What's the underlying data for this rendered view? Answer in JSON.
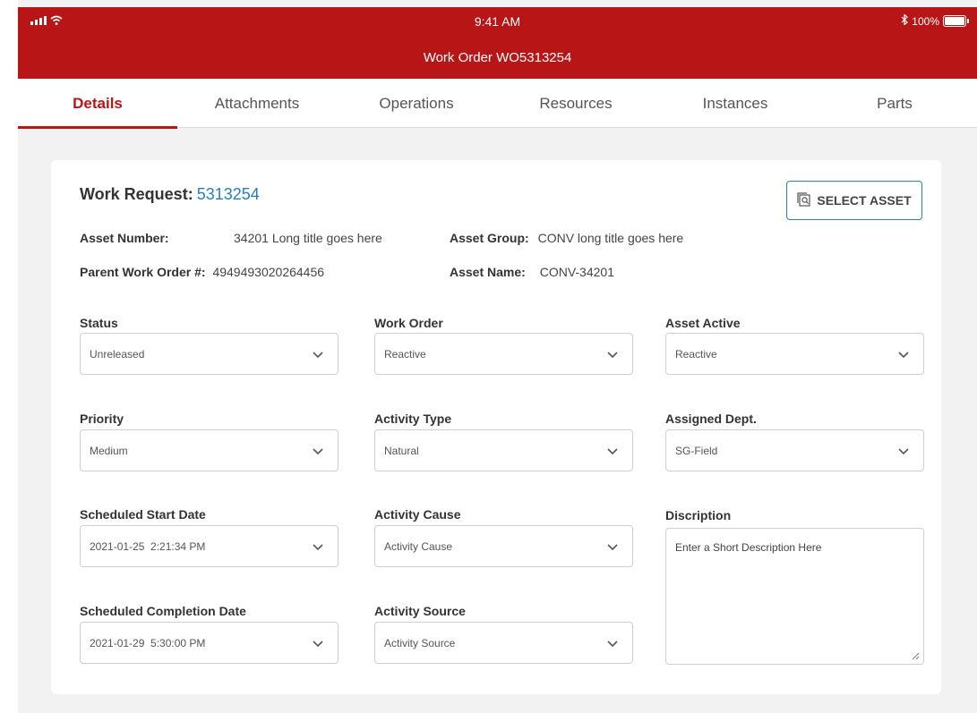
{
  "status_bar": {
    "time": "9:41 AM",
    "battery": "100%",
    "icons": [
      "signal-icon",
      "wifi-icon",
      "bluetooth-icon",
      "battery-icon"
    ]
  },
  "header": {
    "title": "Work Order WO5313254"
  },
  "tabs": [
    {
      "label": "Details",
      "active": true
    },
    {
      "label": "Attachments",
      "active": false
    },
    {
      "label": "Operations",
      "active": false
    },
    {
      "label": "Resources",
      "active": false
    },
    {
      "label": "Instances",
      "active": false
    },
    {
      "label": "Parts",
      "active": false
    }
  ],
  "work_request": {
    "label": "Work Request:",
    "number": "5313254",
    "select_asset_label": "SELECT ASSET"
  },
  "info": {
    "asset_number_label": "Asset Number:",
    "asset_number_value": "34201 Long title goes here",
    "asset_group_label": "Asset Group:",
    "asset_group_value": "CONV long title goes here",
    "parent_wo_label": "Parent Work Order #:",
    "parent_wo_value": "4949493020264456",
    "asset_name_label": "Asset Name:",
    "asset_name_value": "CONV-34201"
  },
  "fields": {
    "status": {
      "label": "Status",
      "value": "Unreleased"
    },
    "work_order": {
      "label": "Work Order",
      "value": "Reactive"
    },
    "asset_active": {
      "label": "Asset Active",
      "value": "Reactive"
    },
    "priority": {
      "label": "Priority",
      "value": "Medium"
    },
    "activity_type": {
      "label": "Activity Type",
      "value": "Natural"
    },
    "assigned_dept": {
      "label": "Assigned Dept.",
      "value": "SG-Field"
    },
    "scheduled_start": {
      "label": "Scheduled Start Date",
      "value": "2021-01-25  2:21:34 PM"
    },
    "activity_cause": {
      "label": "Activity Cause",
      "value": "Activity Cause"
    },
    "description": {
      "label": "Discription",
      "placeholder": "Enter a Short Description Here"
    },
    "scheduled_completion": {
      "label": "Scheduled Completion Date",
      "value": "2021-01-29  5:30:00 PM"
    },
    "activity_source": {
      "label": "Activity Source",
      "value": "Activity Source"
    }
  },
  "colors": {
    "brand_red": "#b81517",
    "link_blue": "#2a7fb8",
    "page_bg": "#f2f2f2"
  }
}
